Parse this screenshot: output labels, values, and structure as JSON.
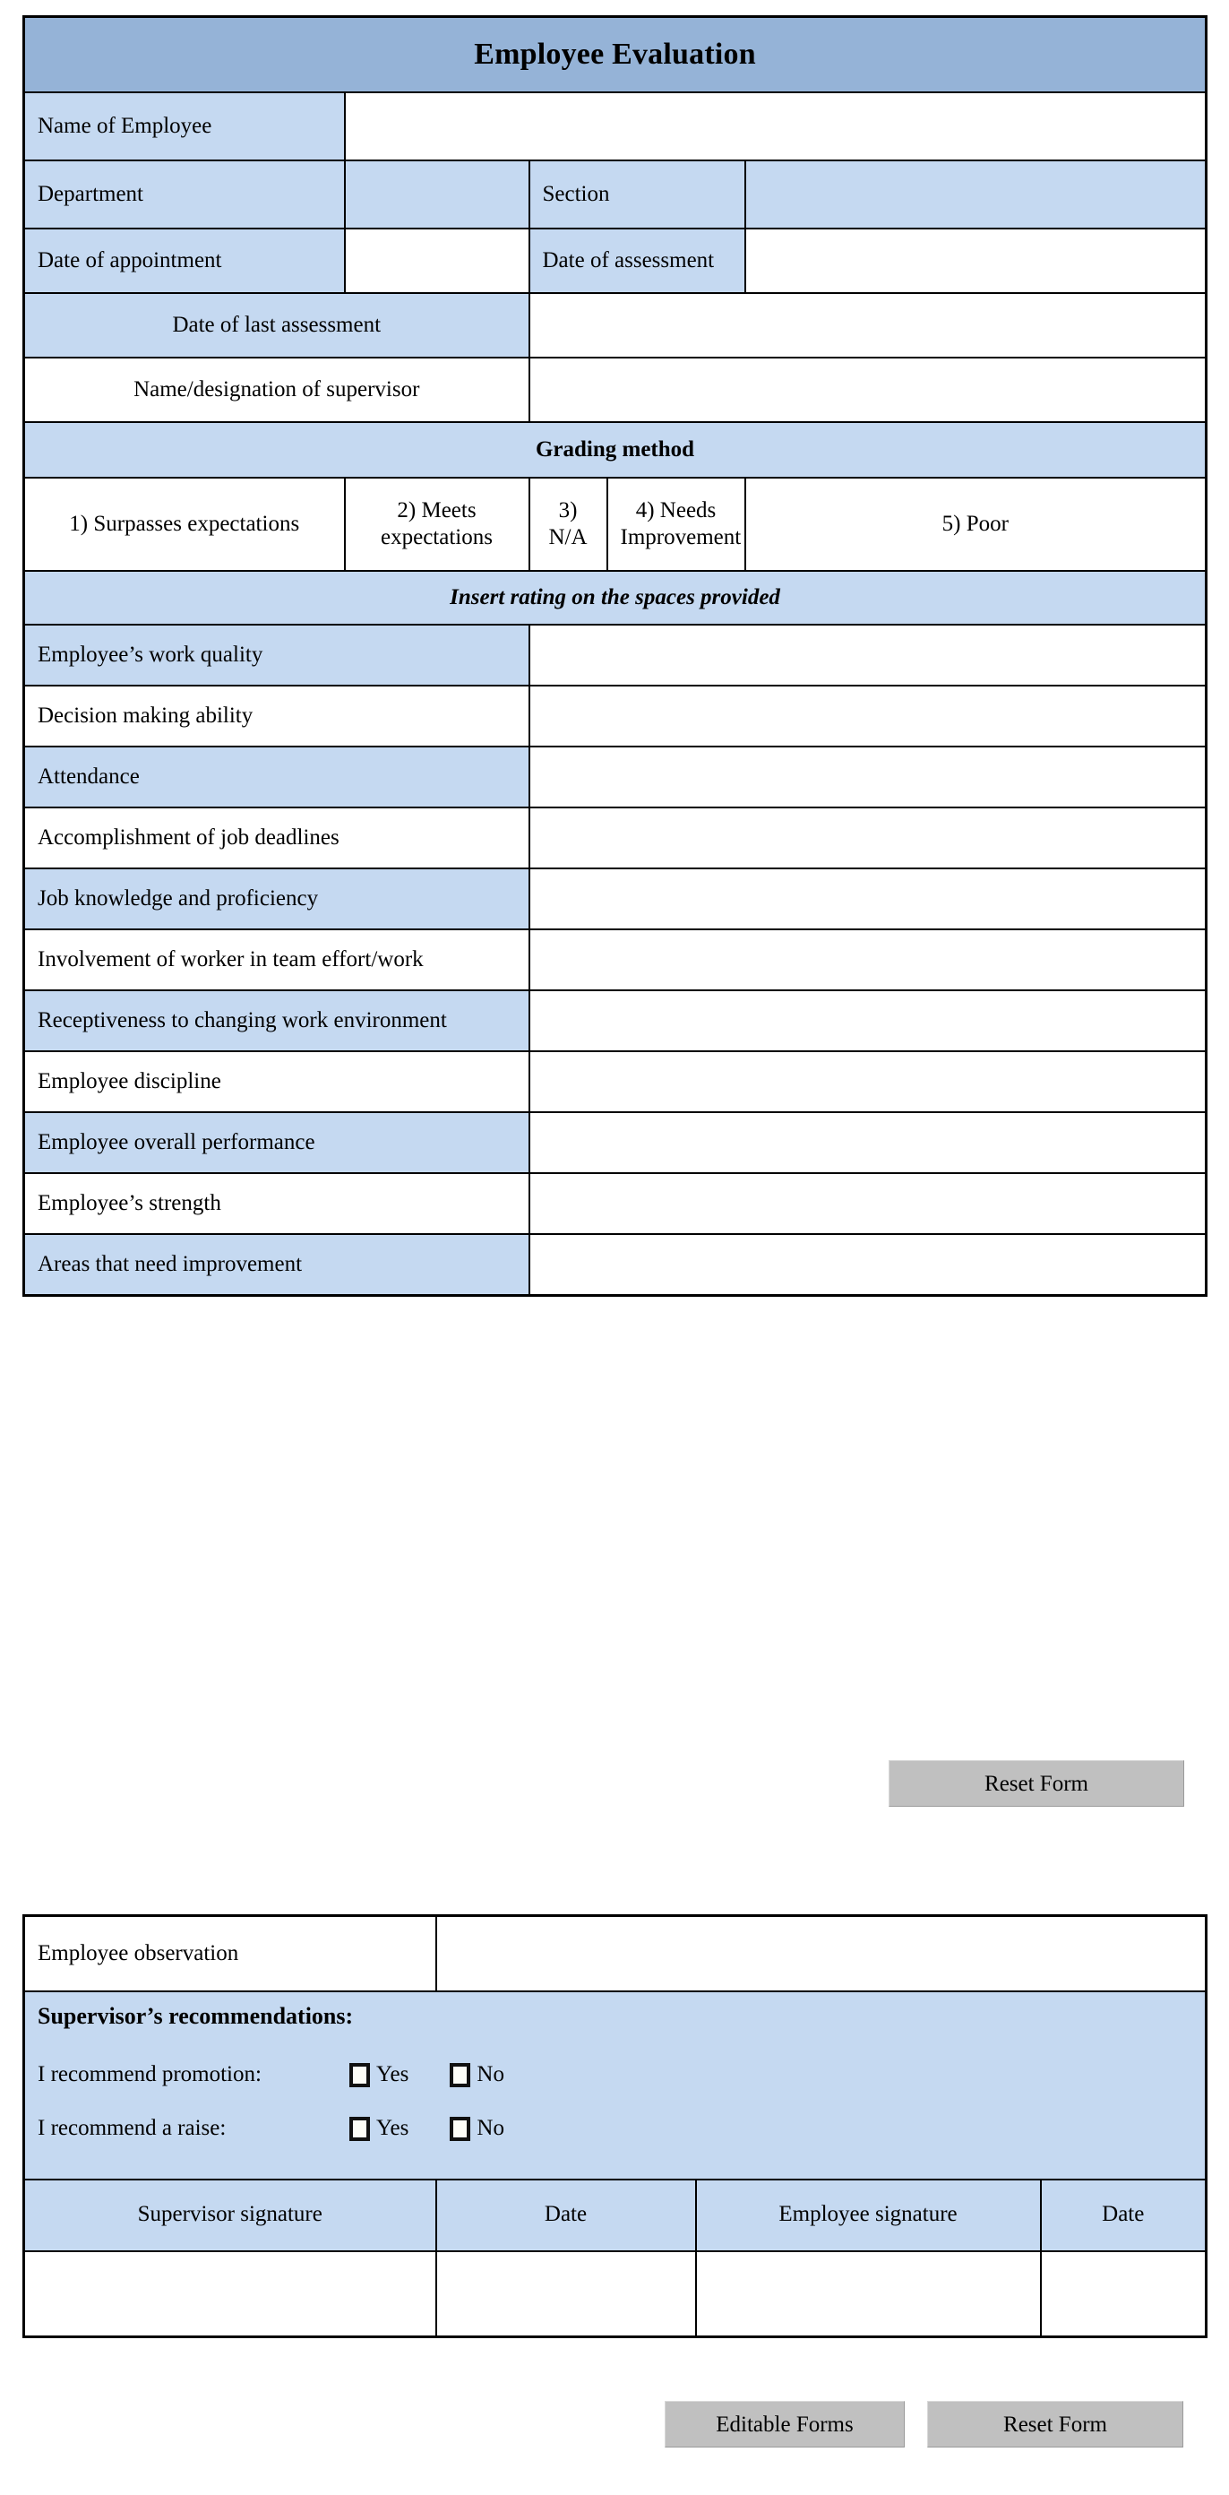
{
  "document": {
    "title": "Employee Evaluation"
  },
  "colors": {
    "title_band": "#95b3d7",
    "row_blue": "#c5d9f1",
    "row_white": "#ffffff",
    "button_gray": "#c0c0c0",
    "border": "#000000"
  },
  "info": {
    "name_of_employee": "Name of Employee",
    "department": "Department",
    "section": "Section",
    "date_of_appointment": "Date of appointment",
    "date_of_assessment": "Date of assessment",
    "date_of_last_assessment": "Date of last assessment",
    "name_designation_of_supervisor": "Name/designation of supervisor"
  },
  "grading": {
    "heading": "Grading method",
    "options": [
      "1) Surpasses expectations",
      "2) Meets expectations",
      "3) N/A",
      "4) Needs Improvement",
      "5) Poor"
    ],
    "instruction": "Insert rating on the spaces provided"
  },
  "criteria": [
    "Employee’s work quality",
    "Decision making ability",
    "Attendance",
    "Accomplishment of job deadlines",
    "Job knowledge and proficiency",
    "Involvement of worker in team effort/work",
    "Receptiveness to changing work environment",
    "Employee discipline",
    "Employee overall performance",
    "Employee’s strength",
    "Areas that need improvement"
  ],
  "observation": {
    "label": "Employee observation"
  },
  "recommendations": {
    "heading": "Supervisor’s recommendations:",
    "rows": [
      {
        "label": "I recommend promotion:",
        "yes": "Yes",
        "no": "No"
      },
      {
        "label": "I recommend a raise:",
        "yes": "Yes",
        "no": "No"
      }
    ]
  },
  "signatures": {
    "headers": [
      "Supervisor signature",
      "Date",
      "Employee signature",
      "Date"
    ]
  },
  "buttons": {
    "reset_top": "Reset Form",
    "editable_forms": "Editable Forms",
    "reset_bottom": "Reset Form"
  }
}
